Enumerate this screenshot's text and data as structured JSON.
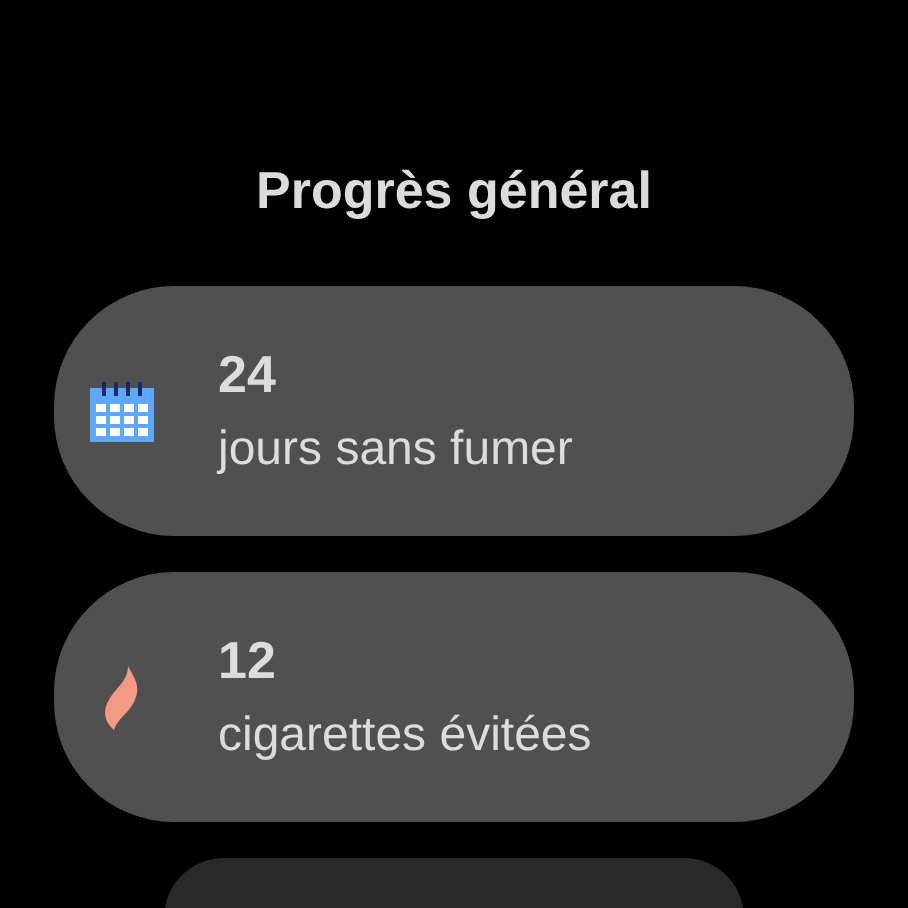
{
  "title": "Progrès général",
  "cards": [
    {
      "kind": "calendar",
      "value": "24",
      "label": "jours sans fumer"
    },
    {
      "kind": "flame",
      "value": "12",
      "label": "cigarettes évitées"
    }
  ]
}
